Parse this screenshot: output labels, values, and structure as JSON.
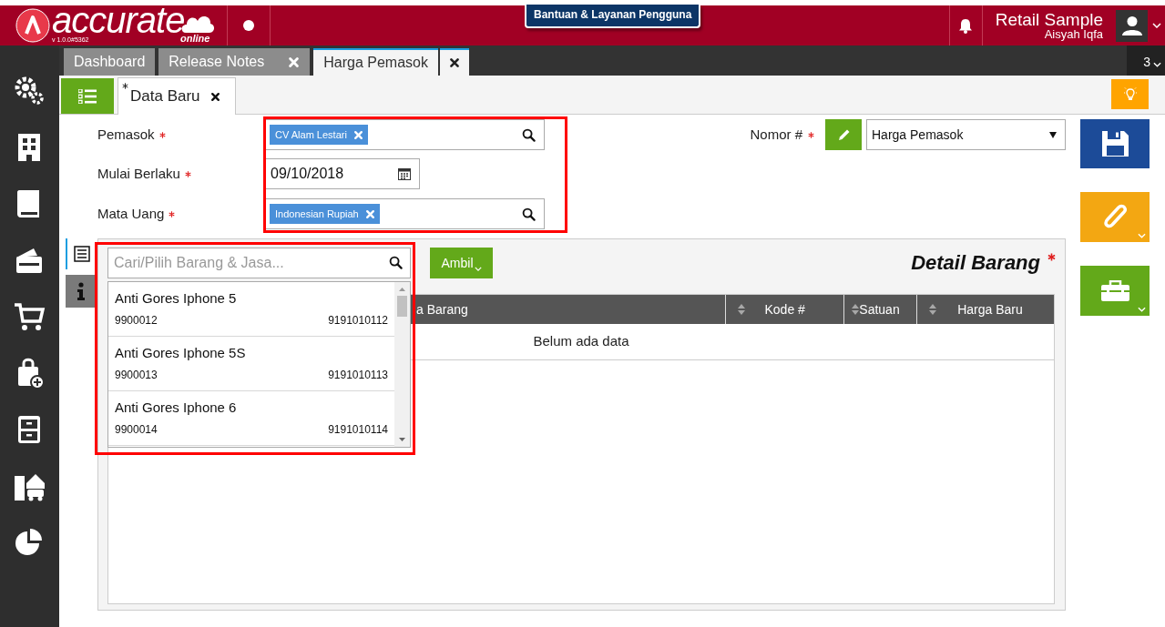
{
  "app": {
    "brand": "accurate",
    "brand_sub": "online",
    "version": "v 1.0.0#5362",
    "help_link": "Bantuan & Layanan Pengguna",
    "company": "Retail Sample",
    "user": "Aisyah Iqfa"
  },
  "tabs": [
    {
      "label": "Dashboard",
      "closable": false,
      "selected": false
    },
    {
      "label": "Release Notes",
      "closable": true,
      "selected": false
    },
    {
      "label": "Harga Pemasok",
      "closable": true,
      "selected": true
    }
  ],
  "tab_count": "3",
  "form_tabs": [
    {
      "label": "Data Baru",
      "modified": true,
      "selected": true
    }
  ],
  "form": {
    "fields": [
      {
        "label": "Pemasok",
        "required": true,
        "kind": "tag",
        "value": "CV Alam Lestari"
      },
      {
        "label": "Mulai Berlaku",
        "required": true,
        "kind": "date",
        "value": "09/10/2018"
      },
      {
        "label": "Mata Uang",
        "required": true,
        "kind": "tag",
        "value": "Indonesian Rupiah"
      }
    ],
    "number": {
      "label": "Nomor #",
      "required": true,
      "value": "Harga Pemasok"
    }
  },
  "side_tabs": [
    {
      "kind": "list",
      "selected": true
    },
    {
      "kind": "info",
      "selected": false
    }
  ],
  "detail": {
    "title": "Detail Barang",
    "required": true,
    "take_button": "Ambil",
    "item_search": {
      "placeholder": "Cari/Pilih Barang & Jasa..."
    },
    "suggestions": [
      {
        "name": "Anti Gores Iphone 5",
        "code": "9900012",
        "barcode": "9191010112"
      },
      {
        "name": "Anti Gores Iphone 5S",
        "code": "9900013",
        "barcode": "9191010113"
      },
      {
        "name": "Anti Gores Iphone 6",
        "code": "9900014",
        "barcode": "9191010114"
      }
    ],
    "columns": [
      "a Barang",
      "Kode #",
      "Satuan",
      "Harga Baru"
    ],
    "empty_text": "Belum ada data"
  }
}
